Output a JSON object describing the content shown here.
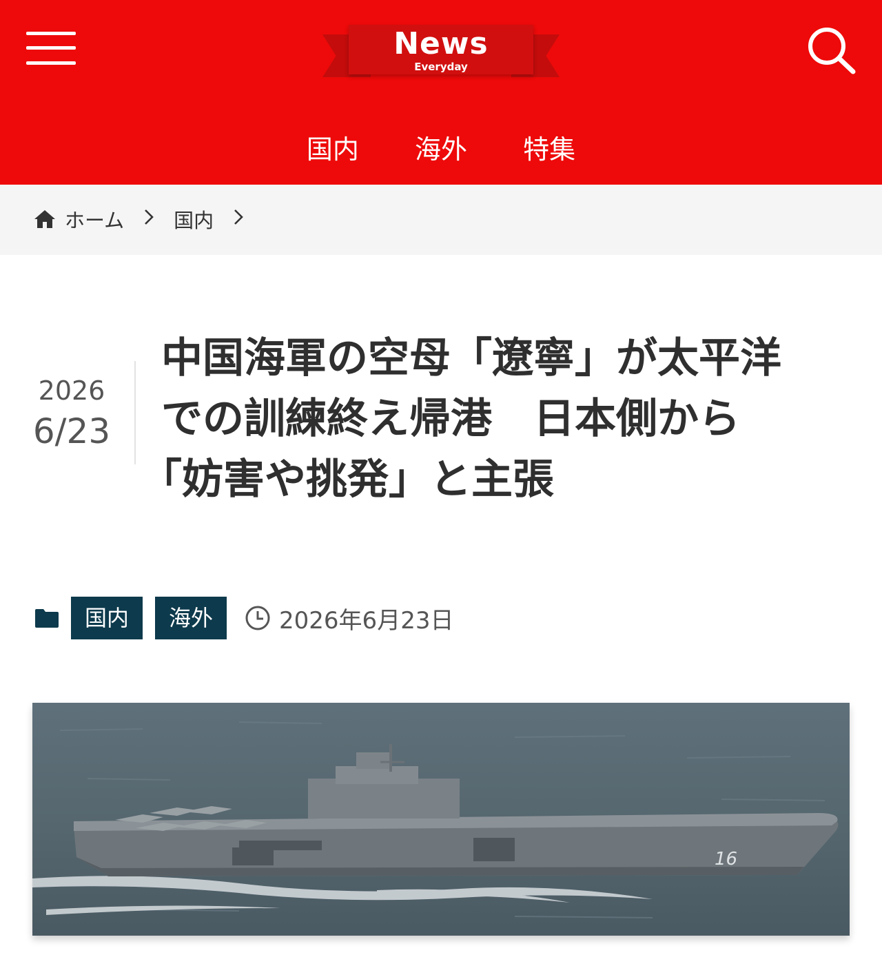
{
  "header": {
    "logo_word": "News",
    "logo_sub": "Everyday",
    "nav": [
      "国内",
      "海外",
      "特集"
    ]
  },
  "breadcrumb": {
    "home": "ホーム",
    "category": "国内"
  },
  "article": {
    "date_year": "2026",
    "date_md": "6/23",
    "title_line1": "中国海軍の空母「遼寧」が太平洋",
    "title_line2": "での訓練終え帰港　日本側から",
    "title_line3": "「妨害や挑発」と主張",
    "categories": [
      "国内",
      "海外"
    ],
    "published": "2026年6月23日",
    "hull_number": "16"
  },
  "icons": [
    "menu-icon",
    "search-icon",
    "home-icon",
    "chevron-right-icon",
    "folder-icon",
    "clock-icon"
  ],
  "colors": {
    "header_red": "#ee0a0a",
    "category_navy": "#0d3a4c",
    "breadcrumb_bg": "#f5f5f5"
  }
}
